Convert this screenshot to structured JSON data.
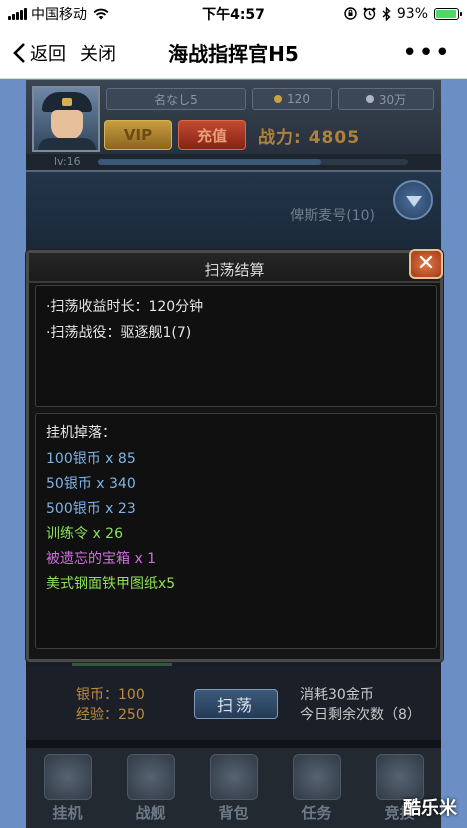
{
  "status_bar": {
    "carrier": "中国移动",
    "time": "下午4:57",
    "battery_text": "93%",
    "battery_level": 0.93,
    "icons": [
      "signal-icon",
      "wifi-icon",
      "rotation-lock-icon",
      "alarm-icon",
      "bluetooth-icon",
      "battery-icon"
    ]
  },
  "nav": {
    "back_label": "返回",
    "close_label": "关闭",
    "title": "海战指挥官H5",
    "more_label": "•••"
  },
  "player": {
    "name": "名なし5",
    "gold": "120",
    "silver": "30万",
    "vip_label": "VIP",
    "recharge_label": "充值",
    "power": "战力: 4805",
    "level": "lv:16",
    "level_progress": 0.72
  },
  "scene": {
    "ship_name": "俾斯麦号(10)"
  },
  "modal": {
    "title": "扫荡结算",
    "close_icon": "close-icon",
    "duration_line": "·扫荡收益时长：120分钟",
    "campaign_line": "·扫荡战役：驱逐舰1(7)",
    "drops_title": "挂机掉落：",
    "drops": [
      {
        "text": "100银币 x 85",
        "color": "#7fb3e6"
      },
      {
        "text": "50银币 x 340",
        "color": "#7fb3e6"
      },
      {
        "text": "500银币 x 23",
        "color": "#7fb3e6"
      },
      {
        "text": "训练令 x 26",
        "color": "#8fe05a"
      },
      {
        "text": "被遗忘的宝箱 x 1",
        "color": "#d06ee0"
      },
      {
        "text": "美式钢面铁甲图纸x5",
        "color": "#8fe05a"
      }
    ]
  },
  "rewards": {
    "silver_label": "银币：",
    "silver_value": "100",
    "exp_label": "经验：",
    "exp_value": "250",
    "sweep_label": "扫荡",
    "cost_text": "消耗30金币",
    "remain_text": "今日剩余次数（8）"
  },
  "tabs": [
    {
      "label": "挂机",
      "icon": "idle-icon"
    },
    {
      "label": "战舰",
      "icon": "warship-icon"
    },
    {
      "label": "背包",
      "icon": "backpack-icon"
    },
    {
      "label": "任务",
      "icon": "task-icon"
    },
    {
      "label": "竞技",
      "icon": "arena-icon"
    }
  ],
  "watermark": "酷乐米"
}
